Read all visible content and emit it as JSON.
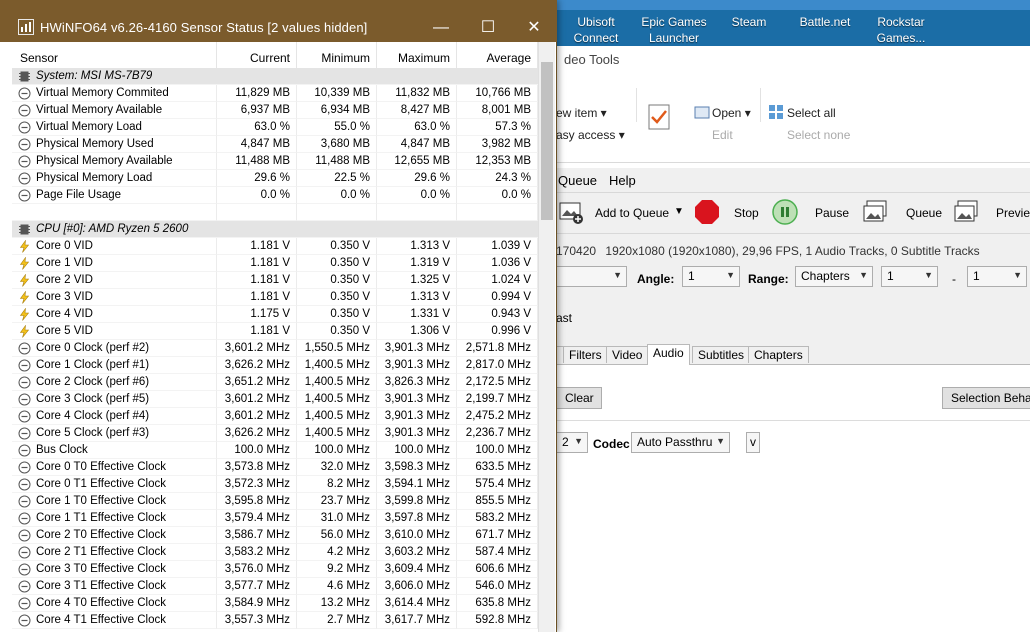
{
  "desktop": {
    "icons": [
      {
        "label": "Ubisoft Connect",
        "icon": "ubisoft-icon"
      },
      {
        "label": "Epic Games Launcher",
        "icon": "epic-games-icon"
      },
      {
        "label": "Steam",
        "icon": "steam-icon"
      },
      {
        "label": "Battle.net",
        "icon": "battlenet-icon"
      },
      {
        "label": "Rockstar Games...",
        "icon": "rockstar-icon"
      }
    ]
  },
  "explorer": {
    "title_partial": "deo Tools",
    "new_item": "ew item ▾",
    "easy_access": "asy access ▾",
    "open": "Open ▾",
    "edit": "Edit",
    "select_all": "Select all",
    "select_none": "Select none"
  },
  "handbrake": {
    "menu": {
      "queue": "Queue",
      "help": "Help"
    },
    "toolbar": {
      "add_to_queue": "Add to Queue",
      "stop": "Stop",
      "pause": "Pause",
      "queue": "Queue",
      "preview": "Previe"
    },
    "source_info_prefix": "170420",
    "source_info": "1920x1080 (1920x1080), 29,96 FPS, 1 Audio Tracks, 0 Subtitle Tracks",
    "angle_label": "Angle:",
    "angle_value": "1",
    "range_label": "Range:",
    "range_type": "Chapters",
    "range_start": "1",
    "range_sep": "-",
    "range_end": "1",
    "preset_partial": "ast",
    "tabs": [
      "Filters",
      "Video",
      "Audio",
      "Subtitles",
      "Chapters"
    ],
    "active_tab": "Audio",
    "clear_button": "Clear",
    "selection_button": "Selection Behav",
    "track_partial": "2",
    "codec_label": "Codec",
    "codec_value": "Auto Passthru",
    "extra_dd": "v"
  },
  "hwinfo": {
    "title": "HWiNFO64 v6.26-4160 Sensor Status [2 values hidden]",
    "columns": [
      "Sensor",
      "Current",
      "Minimum",
      "Maximum",
      "Average"
    ],
    "rows": [
      {
        "type": "group",
        "icon": "chip-icon",
        "name": "System: MSI MS-7B79"
      },
      {
        "icon": "gauge-icon",
        "name": "Virtual Memory Commited",
        "cur": "11,829 MB",
        "min": "10,339 MB",
        "max": "11,832 MB",
        "avg": "10,766 MB"
      },
      {
        "icon": "gauge-icon",
        "name": "Virtual Memory Available",
        "cur": "6,937 MB",
        "min": "6,934 MB",
        "max": "8,427 MB",
        "avg": "8,001 MB"
      },
      {
        "icon": "gauge-icon",
        "name": "Virtual Memory Load",
        "cur": "63.0 %",
        "min": "55.0 %",
        "max": "63.0 %",
        "avg": "57.3 %"
      },
      {
        "icon": "gauge-icon",
        "name": "Physical Memory Used",
        "cur": "4,847 MB",
        "min": "3,680 MB",
        "max": "4,847 MB",
        "avg": "3,982 MB"
      },
      {
        "icon": "gauge-icon",
        "name": "Physical Memory Available",
        "cur": "11,488 MB",
        "min": "11,488 MB",
        "max": "12,655 MB",
        "avg": "12,353 MB"
      },
      {
        "icon": "gauge-icon",
        "name": "Physical Memory Load",
        "cur": "29.6 %",
        "min": "22.5 %",
        "max": "29.6 %",
        "avg": "24.3 %"
      },
      {
        "icon": "gauge-icon",
        "name": "Page File Usage",
        "cur": "0.0 %",
        "min": "0.0 %",
        "max": "0.0 %",
        "avg": "0.0 %"
      },
      {
        "type": "blank"
      },
      {
        "type": "group",
        "icon": "chip-icon",
        "name": "CPU [#0]: AMD Ryzen 5 2600"
      },
      {
        "icon": "lightning-icon",
        "name": "Core 0 VID",
        "cur": "1.181 V",
        "min": "0.350 V",
        "max": "1.313 V",
        "avg": "1.039 V"
      },
      {
        "icon": "lightning-icon",
        "name": "Core 1 VID",
        "cur": "1.181 V",
        "min": "0.350 V",
        "max": "1.319 V",
        "avg": "1.036 V"
      },
      {
        "icon": "lightning-icon",
        "name": "Core 2 VID",
        "cur": "1.181 V",
        "min": "0.350 V",
        "max": "1.325 V",
        "avg": "1.024 V"
      },
      {
        "icon": "lightning-icon",
        "name": "Core 3 VID",
        "cur": "1.181 V",
        "min": "0.350 V",
        "max": "1.313 V",
        "avg": "0.994 V"
      },
      {
        "icon": "lightning-icon",
        "name": "Core 4 VID",
        "cur": "1.175 V",
        "min": "0.350 V",
        "max": "1.331 V",
        "avg": "0.943 V"
      },
      {
        "icon": "lightning-icon",
        "name": "Core 5 VID",
        "cur": "1.181 V",
        "min": "0.350 V",
        "max": "1.306 V",
        "avg": "0.996 V"
      },
      {
        "icon": "gauge-icon",
        "name": "Core 0 Clock (perf #2)",
        "cur": "3,601.2 MHz",
        "min": "1,550.5 MHz",
        "max": "3,901.3 MHz",
        "avg": "2,571.8 MHz"
      },
      {
        "icon": "gauge-icon",
        "name": "Core 1 Clock (perf #1)",
        "cur": "3,626.2 MHz",
        "min": "1,400.5 MHz",
        "max": "3,901.3 MHz",
        "avg": "2,817.0 MHz"
      },
      {
        "icon": "gauge-icon",
        "name": "Core 2 Clock (perf #6)",
        "cur": "3,651.2 MHz",
        "min": "1,400.5 MHz",
        "max": "3,826.3 MHz",
        "avg": "2,172.5 MHz"
      },
      {
        "icon": "gauge-icon",
        "name": "Core 3 Clock (perf #5)",
        "cur": "3,601.2 MHz",
        "min": "1,400.5 MHz",
        "max": "3,901.3 MHz",
        "avg": "2,199.7 MHz"
      },
      {
        "icon": "gauge-icon",
        "name": "Core 4 Clock (perf #4)",
        "cur": "3,601.2 MHz",
        "min": "1,400.5 MHz",
        "max": "3,901.3 MHz",
        "avg": "2,475.2 MHz"
      },
      {
        "icon": "gauge-icon",
        "name": "Core 5 Clock (perf #3)",
        "cur": "3,626.2 MHz",
        "min": "1,400.5 MHz",
        "max": "3,901.3 MHz",
        "avg": "2,236.7 MHz"
      },
      {
        "icon": "gauge-icon",
        "name": "Bus Clock",
        "cur": "100.0 MHz",
        "min": "100.0 MHz",
        "max": "100.0 MHz",
        "avg": "100.0 MHz"
      },
      {
        "icon": "gauge-icon",
        "name": "Core 0 T0 Effective Clock",
        "cur": "3,573.8 MHz",
        "min": "32.0 MHz",
        "max": "3,598.3 MHz",
        "avg": "633.5 MHz"
      },
      {
        "icon": "gauge-icon",
        "name": "Core 0 T1 Effective Clock",
        "cur": "3,572.3 MHz",
        "min": "8.2 MHz",
        "max": "3,594.1 MHz",
        "avg": "575.4 MHz"
      },
      {
        "icon": "gauge-icon",
        "name": "Core 1 T0 Effective Clock",
        "cur": "3,595.8 MHz",
        "min": "23.7 MHz",
        "max": "3,599.8 MHz",
        "avg": "855.5 MHz"
      },
      {
        "icon": "gauge-icon",
        "name": "Core 1 T1 Effective Clock",
        "cur": "3,579.4 MHz",
        "min": "31.0 MHz",
        "max": "3,597.8 MHz",
        "avg": "583.2 MHz"
      },
      {
        "icon": "gauge-icon",
        "name": "Core 2 T0 Effective Clock",
        "cur": "3,586.7 MHz",
        "min": "56.0 MHz",
        "max": "3,610.0 MHz",
        "avg": "671.7 MHz"
      },
      {
        "icon": "gauge-icon",
        "name": "Core 2 T1 Effective Clock",
        "cur": "3,583.2 MHz",
        "min": "4.2 MHz",
        "max": "3,603.2 MHz",
        "avg": "587.4 MHz"
      },
      {
        "icon": "gauge-icon",
        "name": "Core 3 T0 Effective Clock",
        "cur": "3,576.0 MHz",
        "min": "9.2 MHz",
        "max": "3,609.4 MHz",
        "avg": "606.6 MHz"
      },
      {
        "icon": "gauge-icon",
        "name": "Core 3 T1 Effective Clock",
        "cur": "3,577.7 MHz",
        "min": "4.6 MHz",
        "max": "3,606.0 MHz",
        "avg": "546.0 MHz"
      },
      {
        "icon": "gauge-icon",
        "name": "Core 4 T0 Effective Clock",
        "cur": "3,584.9 MHz",
        "min": "13.2 MHz",
        "max": "3,614.4 MHz",
        "avg": "635.8 MHz"
      },
      {
        "icon": "gauge-icon",
        "name": "Core 4 T1 Effective Clock",
        "cur": "3,557.3 MHz",
        "min": "2.7 MHz",
        "max": "3,617.7 MHz",
        "avg": "592.8 MHz"
      }
    ]
  },
  "colors": {
    "hwinfo_titlebar": "#7b5b2c",
    "desktop_bg": "#1b6da6",
    "group_row": "#e4e4e4",
    "stop_red": "#d9141e",
    "pause_green": "#4caf50"
  }
}
